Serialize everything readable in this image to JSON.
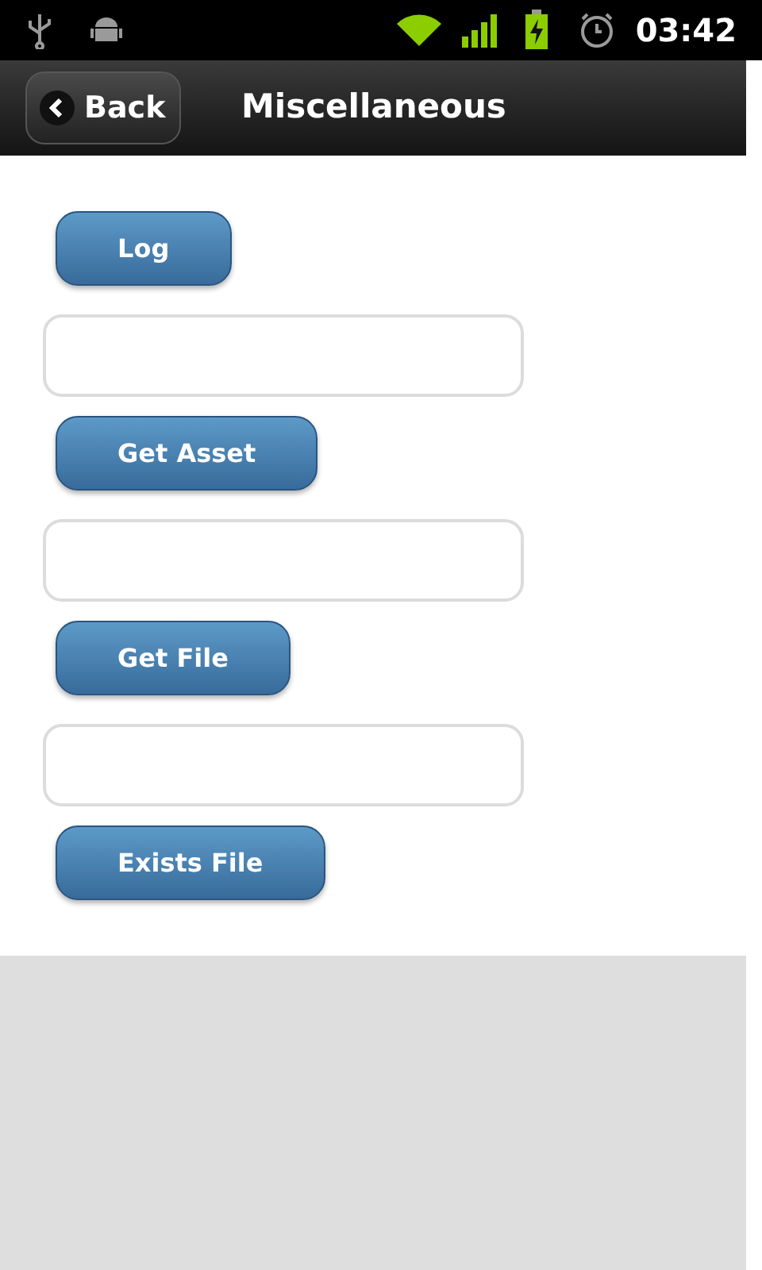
{
  "status_bar": {
    "time": "03:42"
  },
  "header": {
    "back": "Back",
    "title": "Miscellaneous"
  },
  "items": [
    {
      "kind": "button",
      "label": "Log"
    },
    {
      "kind": "field"
    },
    {
      "kind": "button",
      "label": "Get Asset"
    },
    {
      "kind": "field"
    },
    {
      "kind": "button",
      "label": "Get File"
    },
    {
      "kind": "field"
    },
    {
      "kind": "button",
      "label": "Exists File"
    }
  ]
}
